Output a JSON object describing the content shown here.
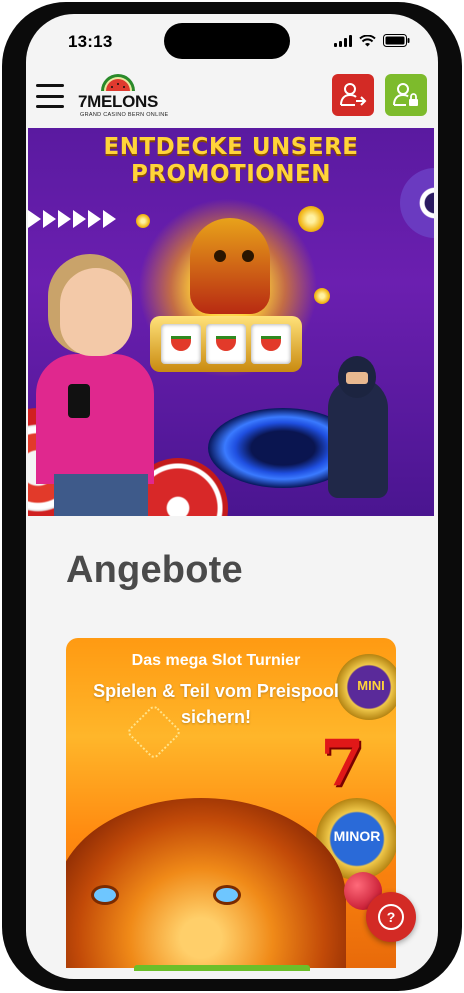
{
  "status_bar": {
    "time": "13:13",
    "icons": [
      "cellular-signal-icon",
      "wifi-icon",
      "battery-icon"
    ]
  },
  "header": {
    "logo": {
      "brand": "7MELONS",
      "tagline": "GRAND CASINO BERN ONLINE"
    },
    "menu_icon": "hamburger-menu-icon",
    "register_icon": "user-arrow-icon",
    "login_icon": "user-lock-icon",
    "colors": {
      "register": "#d32a25",
      "login": "#7dbb2c"
    }
  },
  "hero": {
    "title_line1": "ENTDECKE UNSERE",
    "title_line2": "PROMOTIONEN",
    "colors": {
      "background": "#5a1aa0",
      "title": "#ffd43a"
    }
  },
  "offers": {
    "title": "Angebote",
    "card": {
      "headline": "Das mega Slot Turnier",
      "subline": "Spielen & Teil vom Preispool sichern!",
      "badge_top": "MINI",
      "badge_bottom": "MINOR"
    }
  },
  "help_button": {
    "icon": "question-mark-icon",
    "symbol": "?",
    "color": "#d32a25"
  }
}
